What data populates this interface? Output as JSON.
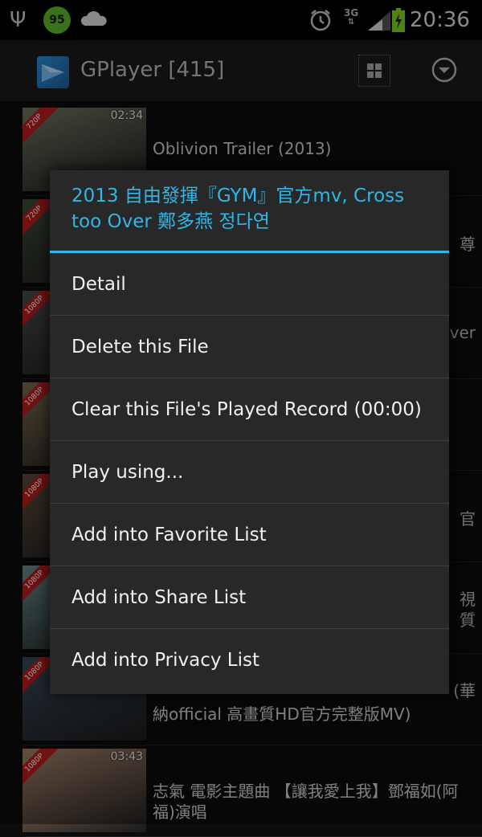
{
  "status_bar": {
    "battery_percent": "95",
    "network": "3G",
    "time": "20:36"
  },
  "app_bar": {
    "title": "GPlayer [415]"
  },
  "list": [
    {
      "badge": "720P",
      "duration": "02:34",
      "title": "Oblivion Trailer (2013)",
      "tail": "",
      "thumb_color": "#6f7360"
    },
    {
      "badge": "720P",
      "duration": "",
      "title": "",
      "tail": "尊",
      "thumb_color": "#3f4a3a"
    },
    {
      "badge": "1080P",
      "duration": "",
      "title": "",
      "tail": "ver",
      "thumb_color": "#4a4a4a"
    },
    {
      "badge": "1080P",
      "duration": "",
      "title": "",
      "tail": "",
      "thumb_color": "#7a6a50"
    },
    {
      "badge": "1080P",
      "duration": "",
      "title": "",
      "tail": "官",
      "thumb_color": "#5d4a3a"
    },
    {
      "badge": "1080P",
      "duration": "",
      "title": "",
      "tail": "視",
      "tail2": "質",
      "thumb_color": "#6a8a8a"
    },
    {
      "badge": "1080P",
      "duration": "",
      "title": "納official 高畫質HD官方完整版MV)",
      "tail": "(華",
      "thumb_color": "#3a4a5a"
    },
    {
      "badge": "1080P",
      "duration": "03:43",
      "title": "志氣 電影主題曲 【讓我愛上我】鄧福如(阿福)演唱",
      "tail": "",
      "thumb_color": "#a0806a"
    }
  ],
  "dialog": {
    "title": "2013 自由發揮『GYM』官方mv, Cross too Over 鄭多燕 정다연",
    "items": [
      {
        "label": "Detail"
      },
      {
        "label": "Delete this File"
      },
      {
        "label": "Clear this File's Played Record (00:00)"
      },
      {
        "label": "Play using..."
      },
      {
        "label": "Add into Favorite List"
      },
      {
        "label": "Add into Share List"
      },
      {
        "label": "Add into Privacy List"
      }
    ]
  },
  "colors": {
    "accent": "#33b5e5",
    "dialog_bg": "#282828",
    "ribbon": "#b71c1c"
  }
}
